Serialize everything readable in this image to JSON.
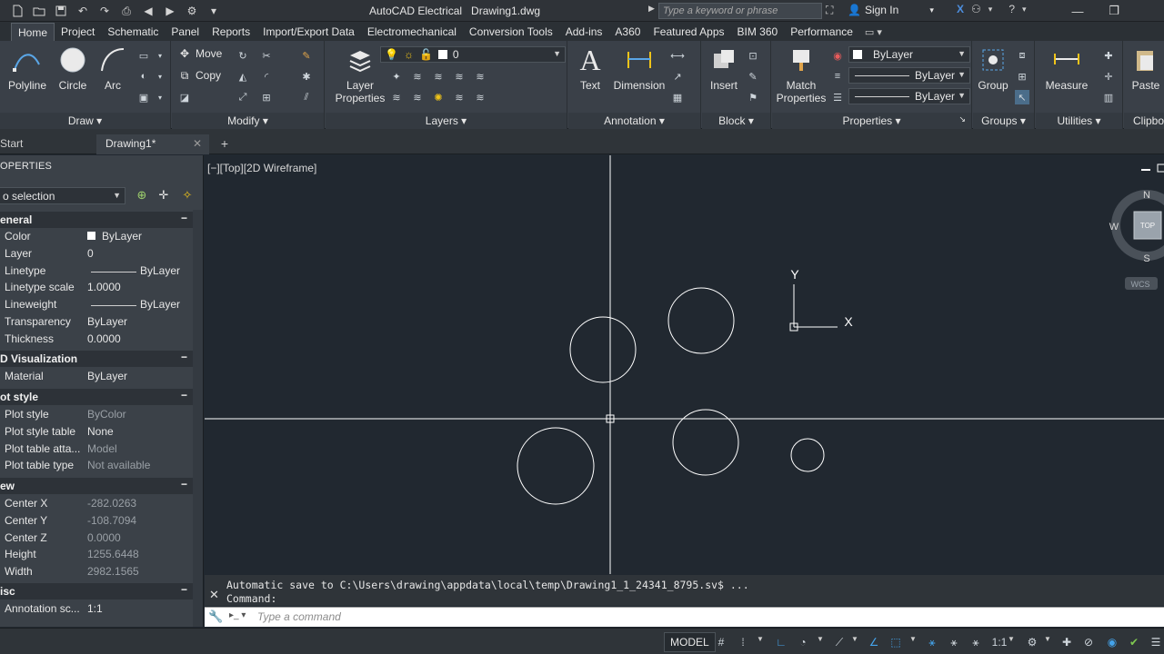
{
  "titlebar": {
    "title": "AutoCAD Electrical   Drawing1.dwg",
    "search_placeholder": "Type a keyword or phrase",
    "signin": "Sign In"
  },
  "ribbon_tabs": [
    "Home",
    "Project",
    "Schematic",
    "Panel",
    "Reports",
    "Import/Export Data",
    "Electromechanical",
    "Conversion Tools",
    "Add-ins",
    "A360",
    "Featured Apps",
    "BIM 360",
    "Performance"
  ],
  "ribbon": {
    "draw": {
      "title": "Draw",
      "polyline": "Polyline",
      "circle": "Circle",
      "arc": "Arc"
    },
    "modify": {
      "title": "Modify",
      "move": "Move",
      "copy": "Copy"
    },
    "layers": {
      "title": "Layers",
      "properties": "Layer\nProperties",
      "properties_l1": "Layer",
      "properties_l2": "Properties",
      "current_layer": "0"
    },
    "annotation": {
      "title": "Annotation",
      "text": "Text",
      "dimension": "Dimension"
    },
    "block": {
      "title": "Block",
      "insert": "Insert"
    },
    "properties": {
      "title": "Properties",
      "match_l1": "Match",
      "match_l2": "Properties",
      "color": "ByLayer",
      "linetype": "ByLayer",
      "lineweight": "ByLayer"
    },
    "groups": {
      "title": "Groups",
      "group": "Group"
    },
    "utilities": {
      "title": "Utilities",
      "measure": "Measure"
    },
    "clipboard": {
      "title": "Clipbo",
      "paste": "Paste"
    }
  },
  "filetabs": {
    "start": "Start",
    "drawing": "Drawing1*"
  },
  "properties_palette": {
    "title": "OPERTIES",
    "selection": "o selection",
    "categories": {
      "general": "eneral",
      "visualization": "D Visualization",
      "plot_style": "ot style",
      "view": "ew",
      "misc": "isc"
    },
    "general": [
      {
        "key": "Color",
        "value": "ByLayer"
      },
      {
        "key": "Layer",
        "value": "0"
      },
      {
        "key": "Linetype",
        "value": "ByLayer"
      },
      {
        "key": "Linetype scale",
        "value": "1.0000"
      },
      {
        "key": "Lineweight",
        "value": "ByLayer"
      },
      {
        "key": "Transparency",
        "value": "ByLayer"
      },
      {
        "key": "Thickness",
        "value": "0.0000"
      }
    ],
    "visualization": [
      {
        "key": "Material",
        "value": "ByLayer"
      }
    ],
    "plot_style": [
      {
        "key": "Plot style",
        "value": "ByColor"
      },
      {
        "key": "Plot style table",
        "value": "None"
      },
      {
        "key": "Plot table atta...",
        "value": "Model"
      },
      {
        "key": "Plot table type",
        "value": "Not available"
      }
    ],
    "view": [
      {
        "key": "Center X",
        "value": "-282.0263"
      },
      {
        "key": "Center Y",
        "value": "-108.7094"
      },
      {
        "key": "Center Z",
        "value": "0.0000"
      },
      {
        "key": "Height",
        "value": "1255.6448"
      },
      {
        "key": "Width",
        "value": "2982.1565"
      }
    ],
    "misc": [
      {
        "key": "Annotation sc...",
        "value": "1:1"
      }
    ]
  },
  "viewport": {
    "label": "[−][Top][2D Wireframe]",
    "viewcube": {
      "top": "TOP",
      "north": "N",
      "south": "S",
      "west": "W",
      "wcs": "WCS"
    },
    "ucs": {
      "x": "X",
      "y": "Y"
    }
  },
  "command": {
    "history_line1": "Automatic save to C:\\Users\\drawing\\appdata\\local\\temp\\Drawing1_1_24341_8795.sv$ ...",
    "history_line2": "Command:",
    "placeholder": "Type a command"
  },
  "statusbar": {
    "model": "MODEL",
    "scale": "1:1"
  },
  "colors": {
    "canvas": "#212830",
    "ui_dark": "#3b4148",
    "accent_blue": "#44a3ea"
  }
}
